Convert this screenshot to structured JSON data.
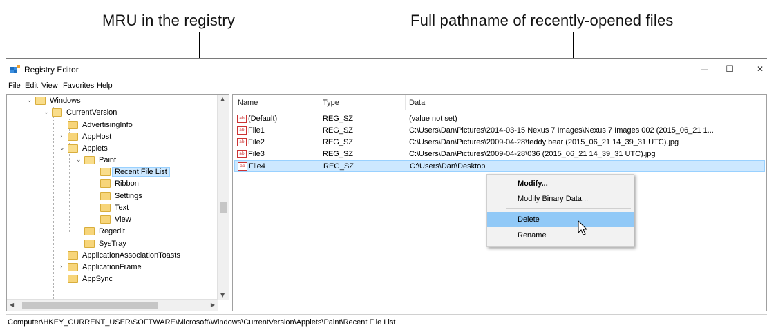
{
  "annotations": {
    "left": "MRU in the registry",
    "right": "Full pathname of recently-opened files"
  },
  "window": {
    "title": "Registry Editor",
    "controls": {
      "minimize": "—",
      "maximize": "☐",
      "close": "✕"
    }
  },
  "menu": [
    "File",
    "Edit",
    "View",
    "Favorites",
    "Help"
  ],
  "tree": {
    "items": [
      {
        "label": "Windows",
        "expanded": true
      },
      {
        "label": "CurrentVersion",
        "expanded": true
      },
      {
        "label": "AdvertisingInfo"
      },
      {
        "label": "AppHost"
      },
      {
        "label": "Applets",
        "expanded": true
      },
      {
        "label": "Paint",
        "expanded": true
      },
      {
        "label": "Recent File List",
        "selected": true
      },
      {
        "label": "Ribbon"
      },
      {
        "label": "Settings"
      },
      {
        "label": "Text"
      },
      {
        "label": "View"
      },
      {
        "label": "Regedit"
      },
      {
        "label": "SysTray"
      },
      {
        "label": "ApplicationAssociationToasts"
      },
      {
        "label": "ApplicationFrame"
      },
      {
        "label": "AppSync"
      }
    ]
  },
  "list": {
    "headers": {
      "name": "Name",
      "type": "Type",
      "data": "Data"
    },
    "rows": [
      {
        "icon": "ab",
        "name": "(Default)",
        "type": "REG_SZ",
        "data": "(value not set)"
      },
      {
        "icon": "ab",
        "name": "File1",
        "type": "REG_SZ",
        "data": "C:\\Users\\Dan\\Pictures\\2014-03-15 Nexus 7 Images\\Nexus 7 Images 002 (2015_06_21 1..."
      },
      {
        "icon": "ab",
        "name": "File2",
        "type": "REG_SZ",
        "data": "C:\\Users\\Dan\\Pictures\\2009-04-28\\teddy bear (2015_06_21 14_39_31 UTC).jpg"
      },
      {
        "icon": "ab",
        "name": "File3",
        "type": "REG_SZ",
        "data": "C:\\Users\\Dan\\Pictures\\2009-04-28\\036 (2015_06_21 14_39_31 UTC).jpg"
      },
      {
        "icon": "ab",
        "name": "File4",
        "type": "REG_SZ",
        "data": "C:\\Users\\Dan\\Desktop",
        "selected": true
      }
    ]
  },
  "context_menu": {
    "items": [
      {
        "label": "Modify...",
        "bold": true
      },
      {
        "label": "Modify Binary Data..."
      },
      {
        "label": "Delete",
        "highlighted": true
      },
      {
        "label": "Rename"
      }
    ]
  },
  "status_bar": {
    "path": "Computer\\HKEY_CURRENT_USER\\SOFTWARE\\Microsoft\\Windows\\CurrentVersion\\Applets\\Paint\\Recent File List"
  },
  "colors": {
    "selection_bg": "#cde8ff",
    "selection_border": "#99d1ff",
    "menu_highlight": "#91c9f7",
    "folder": "#f7d57a"
  },
  "icon_ab_glyph": "ab"
}
